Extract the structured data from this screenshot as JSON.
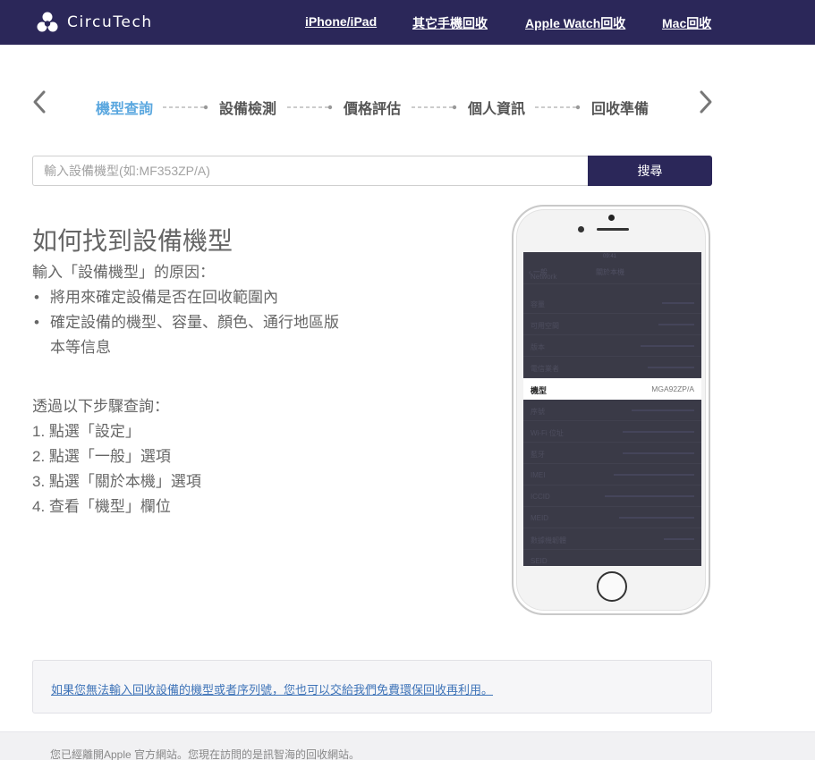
{
  "header": {
    "brand": "CircuTech",
    "logo_icon": "triple-circle-logo-icon",
    "nav": [
      "iPhone/iPad",
      "其它手機回收",
      "Apple Watch回收",
      "Mac回收"
    ]
  },
  "steps": {
    "items": [
      "機型查詢",
      "設備檢測",
      "價格評估",
      "個人資訊",
      "回收準備"
    ],
    "active_index": 0,
    "prev_icon": "chevron-left-icon",
    "next_icon": "chevron-right-icon"
  },
  "search": {
    "placeholder": "輸入設備機型(如:MF353ZP/A)",
    "value": "",
    "button_label": "搜尋"
  },
  "howto": {
    "title": "如何找到設備機型",
    "reason_heading": "輸入「設備機型」的原因：",
    "reasons": [
      "將用來確定設備是否在回收範圍內",
      "確定設備的機型、容量、顏色、通行地區版",
      "本等信息"
    ],
    "steps_heading": "透過以下步驟查詢：",
    "steps": [
      "1. 點選「設定」",
      "2. 點選「一般」選項",
      "3. 點選「關於本機」選項",
      "4. 查看「機型」欄位"
    ]
  },
  "phone": {
    "top_time": "09:41",
    "nav_back": "一般",
    "nav_title": "關於本機",
    "rows": [
      "Network",
      "容量",
      "可用空間",
      "版本",
      "電信業者",
      "機型",
      "序號",
      "Wi-Fi 位址",
      "藍牙",
      "IMEI",
      "ICCID",
      "MEID",
      "數據機韌體",
      "SEID"
    ],
    "highlight_label": "機型",
    "highlight_value": "MGA92ZP/A"
  },
  "notice": {
    "link_text": "如果您無法輸入回收設備的機型或者序列號，您也可以交給我們免費環保回收再利用。"
  },
  "footer": {
    "text": "您已經離開Apple 官方網站。您現在訪問的是訊智海的回收網站。"
  },
  "colors": {
    "header_bg": "#2b2759",
    "active_step": "#5aa7df",
    "link": "#3f74b8"
  }
}
